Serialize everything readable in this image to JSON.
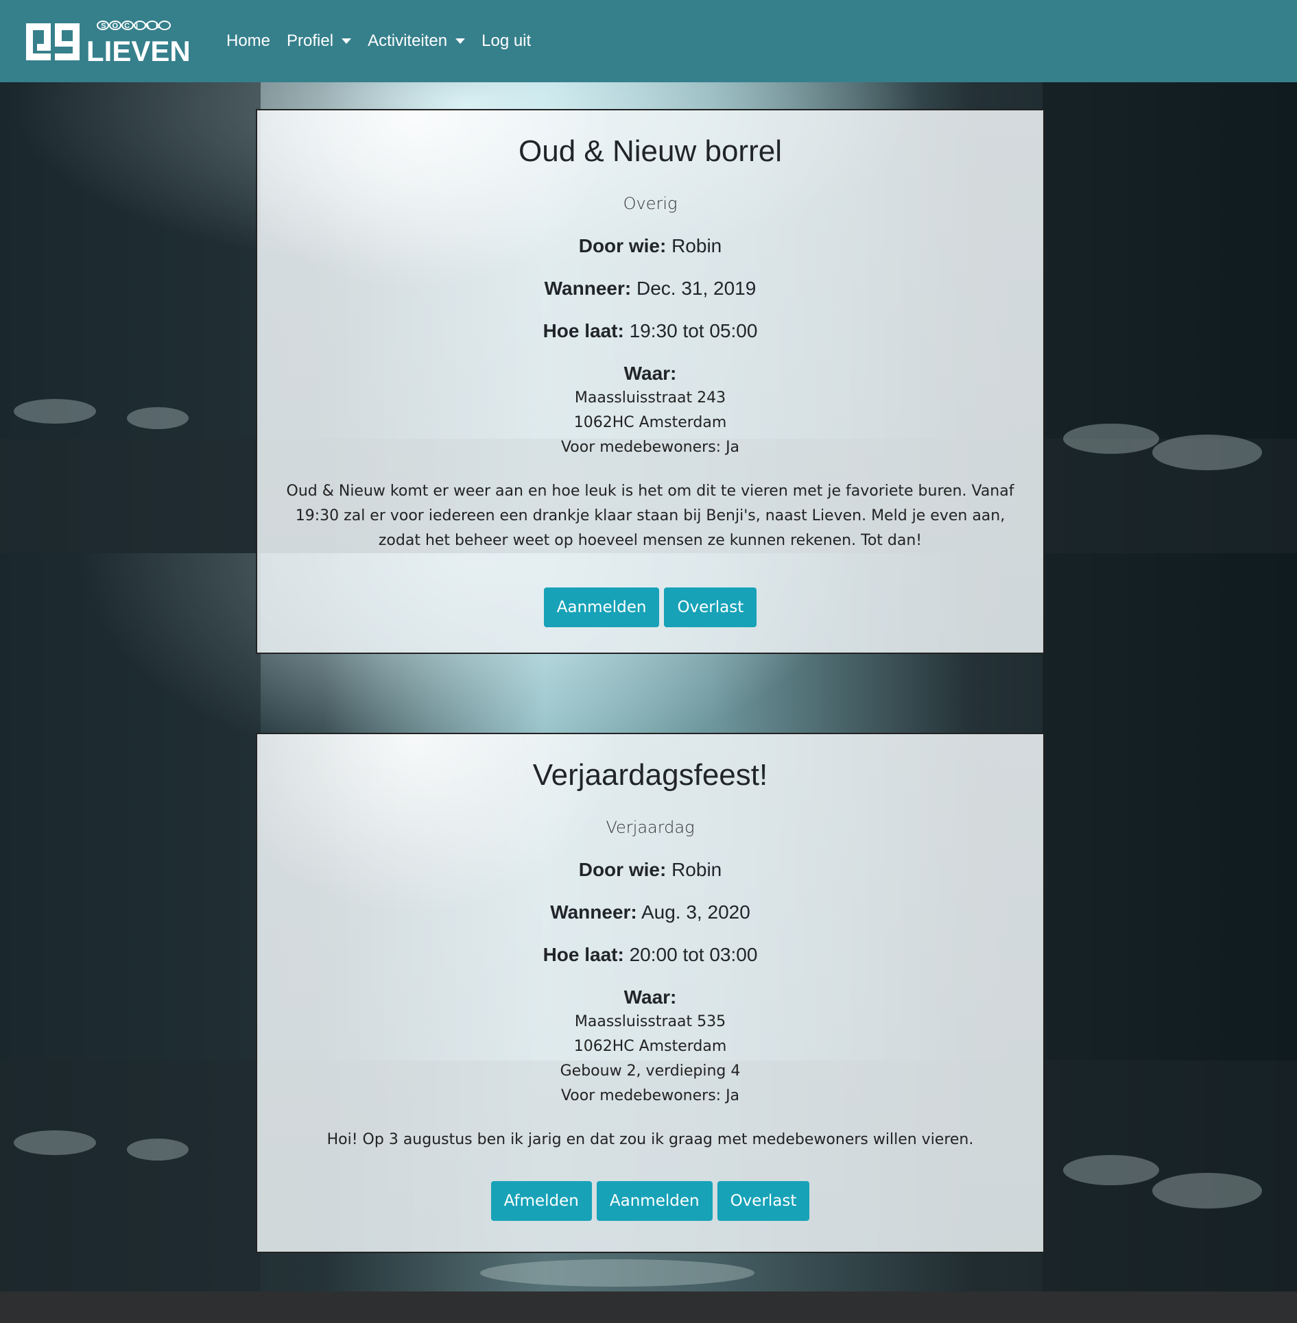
{
  "brand": {
    "logo_top_text": "SOCIAL",
    "logo_name": "LIEVEN",
    "primary_color": "#36808c",
    "button_color": "#17a2b8"
  },
  "nav": {
    "home": "Home",
    "profiel": "Profiel",
    "activiteiten": "Activiteiten",
    "logout": "Log uit"
  },
  "activities": [
    {
      "title": "Oud & Nieuw borrel",
      "category": "Overig",
      "door_label": "Door wie:",
      "door_value": "Robin",
      "wanneer_label": "Wanneer:",
      "wanneer_value": "Dec. 31, 2019",
      "hoelaat_label": "Hoe laat:",
      "hoelaat_value": "19:30 tot 05:00",
      "waar_label": "Waar:",
      "address": [
        "Maassluisstraat 243",
        "1062HC Amsterdam",
        "Voor medebewoners: Ja"
      ],
      "description": "Oud & Nieuw komt er weer aan en hoe leuk is het om dit te vieren met je favoriete buren. Vanaf 19:30 zal er voor iedereen een drankje klaar staan bij Benji's, naast Lieven. Meld je even aan, zodat het beheer weet op hoeveel mensen ze kunnen rekenen. Tot dan!",
      "buttons": [
        "Aanmelden",
        "Overlast"
      ]
    },
    {
      "title": "Verjaardagsfeest!",
      "category": "Verjaardag",
      "door_label": "Door wie:",
      "door_value": "Robin",
      "wanneer_label": "Wanneer:",
      "wanneer_value": "Aug. 3, 2020",
      "hoelaat_label": "Hoe laat:",
      "hoelaat_value": "20:00 tot 03:00",
      "waar_label": "Waar:",
      "address": [
        "Maassluisstraat 535",
        "1062HC Amsterdam",
        "Gebouw 2, verdieping 4",
        "Voor medebewoners: Ja"
      ],
      "description": "Hoi! Op 3 augustus ben ik jarig en dat zou ik graag met medebewoners willen vieren.",
      "buttons": [
        "Afmelden",
        "Aanmelden",
        "Overlast"
      ]
    }
  ]
}
